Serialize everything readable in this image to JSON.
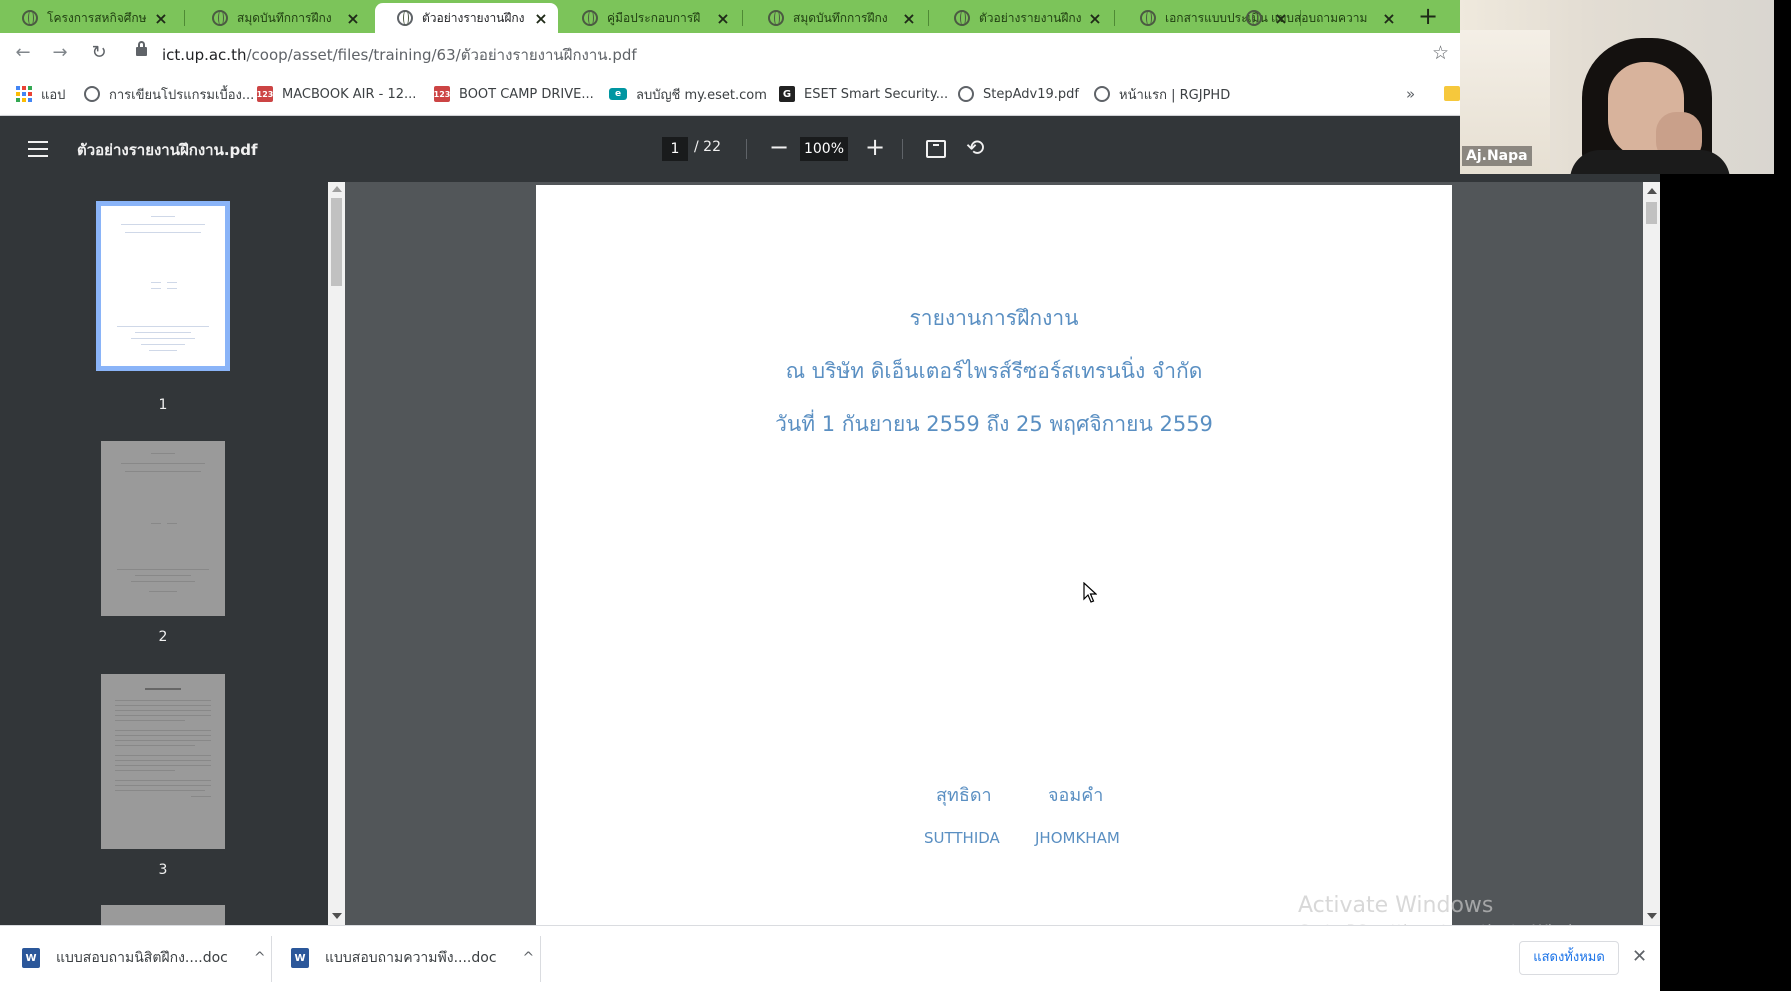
{
  "browser": {
    "tabs": [
      {
        "title": "โครงการสหกิจศึกษ",
        "active": false
      },
      {
        "title": "สมุดบันทึกการฝึกง",
        "active": false
      },
      {
        "title": "ตัวอย่างรายงานฝึกง",
        "active": true
      },
      {
        "title": "คู่มือประกอบการฝึ",
        "active": false
      },
      {
        "title": "สมุดบันทึกการฝึกง",
        "active": false
      },
      {
        "title": "ตัวอย่างรายงานฝึกง",
        "active": false
      },
      {
        "title": "เอกสารแบบประเมิน",
        "active": false
      },
      {
        "title": "แบบสอบถามความ",
        "active": false
      }
    ],
    "new_tab": "+",
    "window_controls": {
      "minimize": "—",
      "restore": "❐",
      "close": "✕"
    },
    "url_host": "ict.up.ac.th",
    "url_path": "/coop/asset/files/training/63/ตัวอย่างรายงานฝึกงาน.pdf",
    "bookmarks": [
      {
        "label": "แอป",
        "icon": "apps-icon"
      },
      {
        "label": "การเขียนโปรแกรมเบื้อง...",
        "icon": "globe-icon"
      },
      {
        "label": "MACBOOK AIR - 12...",
        "icon": "site-123-icon"
      },
      {
        "label": "BOOT CAMP DRIVE...",
        "icon": "site-123-icon"
      },
      {
        "label": "ลบบัญชี my.eset.com",
        "icon": "eset-icon"
      },
      {
        "label": "ESET Smart Security...",
        "icon": "g-icon"
      },
      {
        "label": "StepAdv19.pdf",
        "icon": "globe-icon"
      },
      {
        "label": "หน้าแรก | RGJPHD",
        "icon": "globe-icon"
      }
    ],
    "bookmarks_more": "»"
  },
  "pdf": {
    "title": "ตัวอย่างรายงานฝึกงาน.pdf",
    "current_page": "1",
    "total_pages": "/ 22",
    "zoom": "100%",
    "thumbnails": [
      {
        "number": "1",
        "selected": true
      },
      {
        "number": "2",
        "selected": false
      },
      {
        "number": "3",
        "selected": false
      }
    ],
    "page_content": {
      "line1": "รายงานการฝึกงาน",
      "line2": "ณ บริษัท ดิเอ็นเตอร์ไพรส์รีซอร์สเทรนนิ่ง จำกัด",
      "line3": "วันที่ 1 กันยายน 2559 ถึง 25 พฤศจิกายน 2559",
      "name_th_first": "สุทธิดา",
      "name_th_last": "จอมคำ",
      "name_en_first": "SUTTHIDA",
      "name_en_last": "JHOMKHAM"
    }
  },
  "watermark": {
    "line1": "Activate Windows",
    "line2": "Go to PC settings to activate Windows."
  },
  "downloads": {
    "items": [
      {
        "name": "แบบสอบถามนิสิตฝึกง....doc"
      },
      {
        "name": "แบบสอบถามความพึง....doc"
      }
    ],
    "show_all": "แสดงทั้งหมด",
    "close": "✕"
  },
  "webcam": {
    "name": "Aj.Napa"
  },
  "colors": {
    "tab_strip": "#7cc45a",
    "pdf_toolbar": "#323639",
    "doc_text": "#5a8fc2",
    "thumb_selected": "#8ab4f8"
  }
}
